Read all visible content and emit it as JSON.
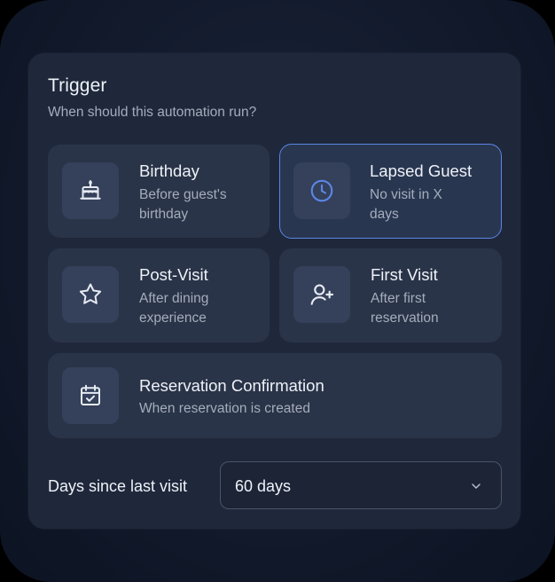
{
  "trigger": {
    "title": "Trigger",
    "subtitle": "When should this automation run?",
    "accent_color": "#5a86e6",
    "options": [
      {
        "title": "Birthday",
        "description": "Before guest's birthday",
        "icon": "cake-icon",
        "selected": false
      },
      {
        "title": "Lapsed Guest",
        "description": "No visit in X days",
        "icon": "clock-icon",
        "selected": true
      },
      {
        "title": "Post-Visit",
        "description": "After dining experience",
        "icon": "star-icon",
        "selected": false
      },
      {
        "title": "First Visit",
        "description": "After first reservation",
        "icon": "user-plus-icon",
        "selected": false
      },
      {
        "title": "Reservation Confirmation",
        "description": "When reservation is created",
        "icon": "calendar-check-icon",
        "selected": false
      }
    ]
  },
  "days_since_last_visit": {
    "label": "Days since last visit",
    "value": "60 days"
  }
}
